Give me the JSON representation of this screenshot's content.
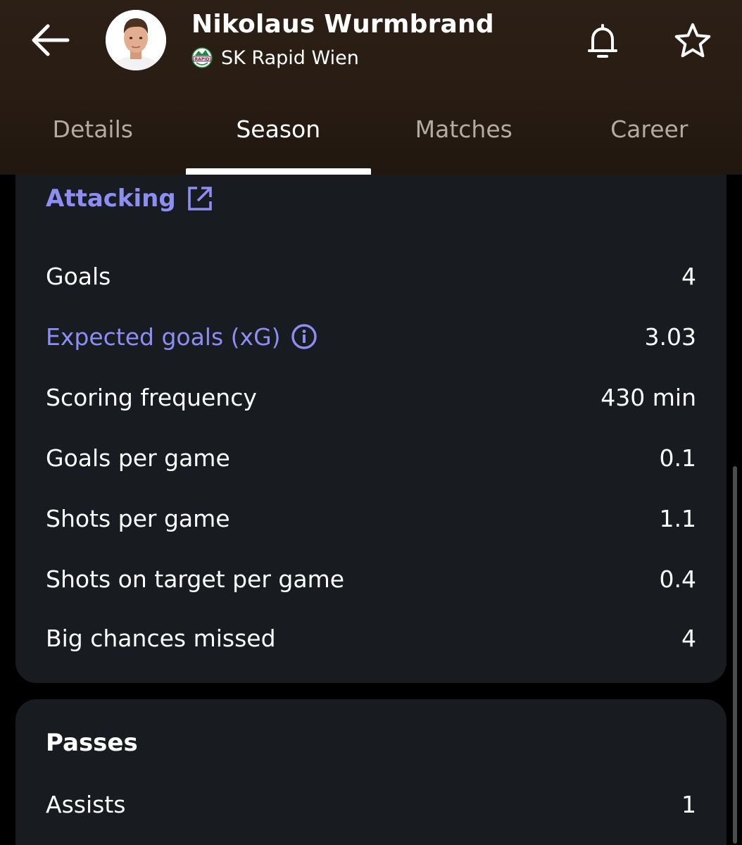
{
  "player": {
    "name": "Nikolaus Wurmbrand",
    "team": "SK Rapid Wien",
    "team_logo_text": "RAPID"
  },
  "header_icons": {
    "back": "arrow-left-icon",
    "notify": "bell-icon",
    "favorite": "star-icon"
  },
  "tabs": [
    {
      "label": "Details",
      "active": false
    },
    {
      "label": "Season",
      "active": true
    },
    {
      "label": "Matches",
      "active": false
    },
    {
      "label": "Career",
      "active": false
    }
  ],
  "attacking": {
    "title": "Attacking",
    "stats": [
      {
        "label": "Goals",
        "value": "4"
      },
      {
        "label": "Expected goals (xG)",
        "value": "3.03"
      },
      {
        "label": "Scoring frequency",
        "value": "430 min"
      },
      {
        "label": "Goals per game",
        "value": "0.1"
      },
      {
        "label": "Shots per game",
        "value": "1.1"
      },
      {
        "label": "Shots on target per game",
        "value": "0.4"
      },
      {
        "label": "Big chances missed",
        "value": "4"
      }
    ]
  },
  "passes": {
    "title": "Passes",
    "stats": [
      {
        "label": "Assists",
        "value": "1"
      }
    ]
  },
  "colors": {
    "accent": "#8d8ef3",
    "header_bg": "#2c1f16",
    "card_bg": "#181c20",
    "inactive_tab": "#b4aba3"
  }
}
